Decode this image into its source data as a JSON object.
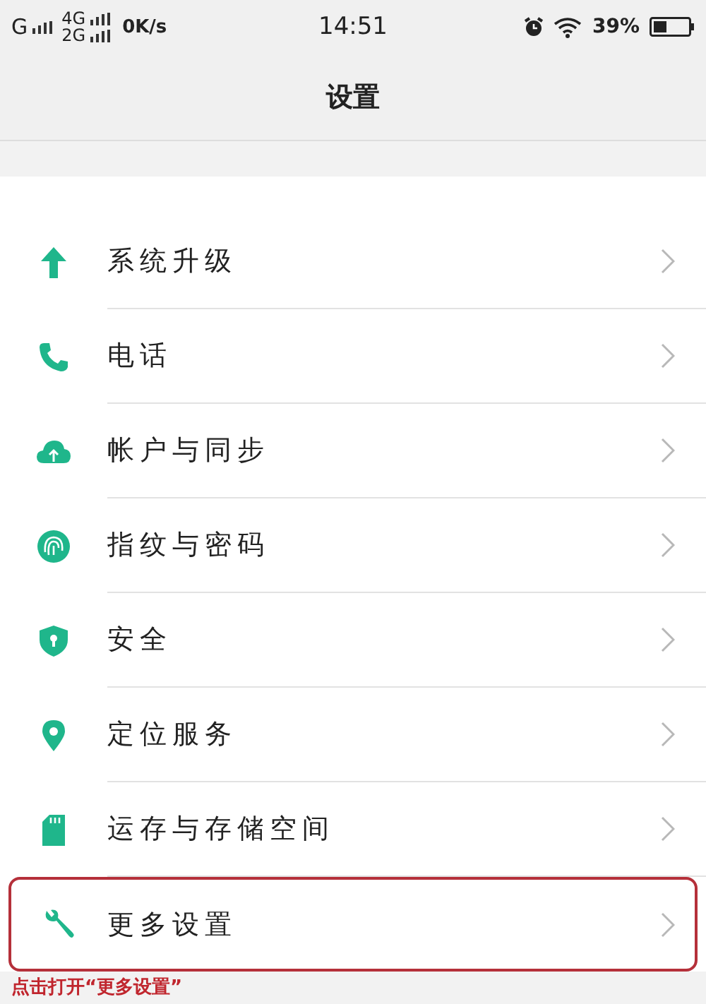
{
  "status_bar": {
    "network": "G",
    "network_4g": "4G",
    "network_2g": "2G",
    "speed": "0K/s",
    "time": "14:51",
    "battery": "39%"
  },
  "header": {
    "title": "设置"
  },
  "settings": [
    {
      "label": "系统升级",
      "highlighted": false
    },
    {
      "label": "电话",
      "highlighted": false
    },
    {
      "label": "帐户与同步",
      "highlighted": false
    },
    {
      "label": "指纹与密码",
      "highlighted": false
    },
    {
      "label": "安全",
      "highlighted": false
    },
    {
      "label": "定位服务",
      "highlighted": false
    },
    {
      "label": "运存与存储空间",
      "highlighted": false
    },
    {
      "label": "更多设置",
      "highlighted": true
    }
  ],
  "annotation": "点击打开“更多设置”"
}
